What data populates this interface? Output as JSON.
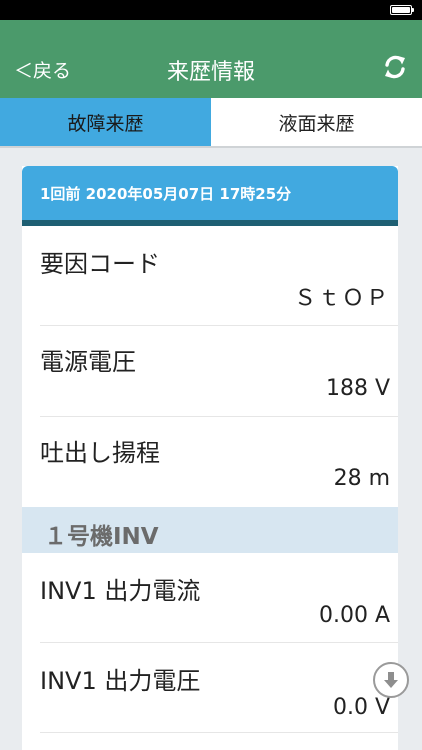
{
  "nav": {
    "back_label": "＜戻る",
    "title": "来歴情報"
  },
  "tabs": [
    {
      "label": "故障来歴",
      "active": true
    },
    {
      "label": "液面来歴",
      "active": false
    }
  ],
  "record": {
    "header": "1回前 2020年05月07日 17時25分",
    "rows": [
      {
        "label": "要因コード",
        "value": "ＳｔＯＰ"
      },
      {
        "label": "電源電圧",
        "value": "188 V"
      },
      {
        "label": "吐出し揚程",
        "value": "28 m"
      }
    ],
    "section": {
      "title": "１号機INV",
      "rows": [
        {
          "label": "INV1 出力電流",
          "value": "0.00 A"
        },
        {
          "label": "INV1 出力電圧",
          "value": "0.0 V"
        }
      ]
    }
  },
  "icons": {
    "refresh": "refresh-icon",
    "scroll": "arrow-down-circle-icon",
    "battery": "battery-icon"
  },
  "colors": {
    "nav_bg": "#4b9a6b",
    "tab_active": "#41a9e0",
    "card_header": "#41a9e0",
    "section_bg": "#d7e6f1"
  }
}
